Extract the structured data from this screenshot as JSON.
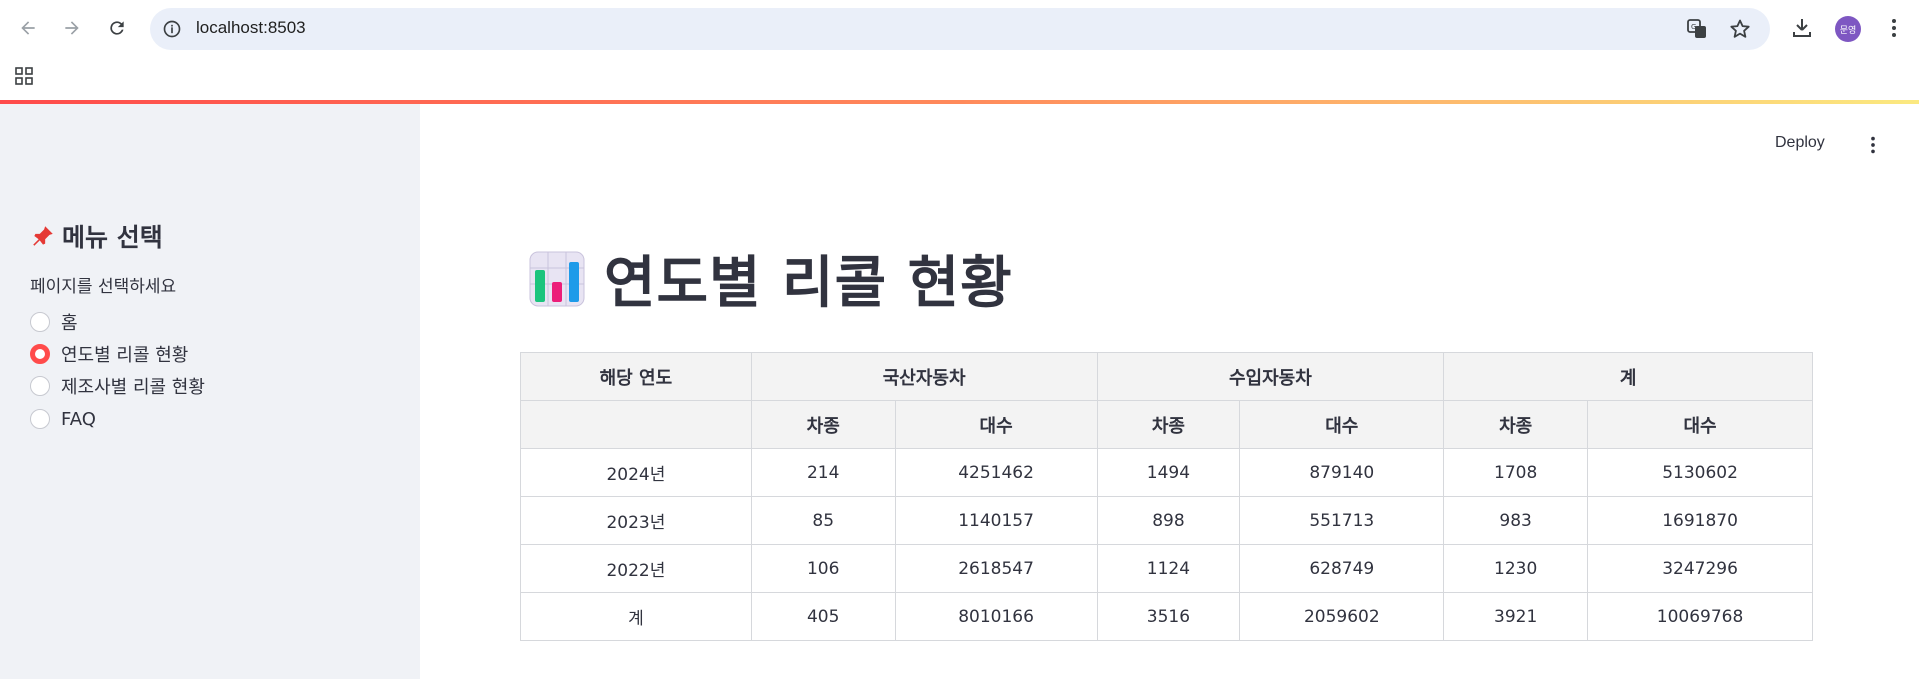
{
  "browser": {
    "url": "localhost:8503",
    "avatar_text": "문영"
  },
  "app": {
    "deploy_label": "Deploy"
  },
  "sidebar": {
    "title": "메뉴 선택",
    "radio_label": "페이지를 선택하세요",
    "options": [
      {
        "label": "홈",
        "selected": false
      },
      {
        "label": "연도별 리콜 현황",
        "selected": true
      },
      {
        "label": "제조사별 리콜 현황",
        "selected": false
      },
      {
        "label": "FAQ",
        "selected": false
      }
    ]
  },
  "page": {
    "title": "연도별 리콜 현황"
  },
  "table": {
    "header_top": [
      "해당 연도",
      "국산자동차",
      "수입자동차",
      "계"
    ],
    "header_sub": [
      "",
      "차종",
      "대수",
      "차종",
      "대수",
      "차종",
      "대수"
    ],
    "rows": [
      [
        "2024년",
        "214",
        "4251462",
        "1494",
        "879140",
        "1708",
        "5130602"
      ],
      [
        "2023년",
        "85",
        "1140157",
        "898",
        "551713",
        "983",
        "1691870"
      ],
      [
        "2022년",
        "106",
        "2618547",
        "1124",
        "628749",
        "1230",
        "3247296"
      ],
      [
        "계",
        "405",
        "8010166",
        "3516",
        "2059602",
        "3921",
        "10069768"
      ]
    ]
  },
  "colors": {
    "accent": "#ff4b4b",
    "sidebar_bg": "#f0f2f6",
    "text": "#31333f",
    "header_bg": "#f3f3f3"
  }
}
